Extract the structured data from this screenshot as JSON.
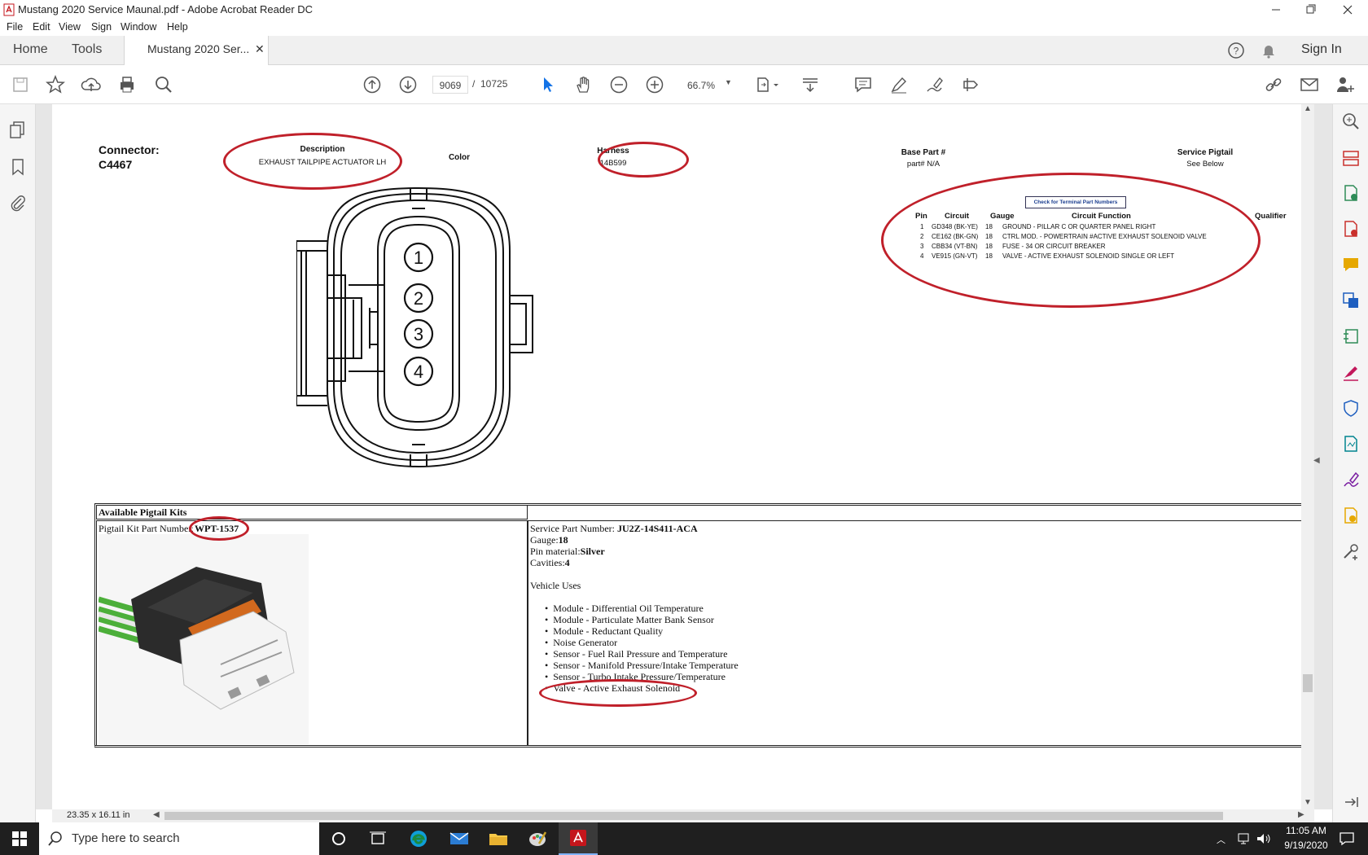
{
  "window": {
    "title": "Mustang 2020 Service Maunal.pdf - Adobe Acrobat Reader DC"
  },
  "menu": [
    "File",
    "Edit",
    "View",
    "Sign",
    "Window",
    "Help"
  ],
  "tabs": {
    "home": "Home",
    "tools": "Tools",
    "document": "Mustang 2020 Ser...",
    "sign_in": "Sign In"
  },
  "toolbar": {
    "page_current": "9069",
    "page_sep": "/",
    "page_total": "10725",
    "zoom": "66.7%"
  },
  "document": {
    "connector_label": "Connector:",
    "connector_id": "C4467",
    "description_label": "Description",
    "description_value": "EXHAUST TAILPIPE ACTUATOR LH",
    "color_label": "Color",
    "harness_label": "Harness",
    "harness_value": "14B599",
    "base_part_label": "Base Part #",
    "base_part_value": "part# N/A",
    "service_pigtail_label": "Service Pigtail",
    "service_pigtail_value": "See Below",
    "terminal_button": "Check for Terminal Part Numbers",
    "pin_table": {
      "headers": [
        "Pin",
        "Circuit",
        "Gauge",
        "Circuit Function",
        "Qualifier"
      ],
      "rows": [
        [
          "1",
          "GD348 (BK-YE)",
          "18",
          "GROUND - PILLAR C OR QUARTER PANEL RIGHT"
        ],
        [
          "2",
          "CE162 (BK-GN)",
          "18",
          "CTRL MOD. - POWERTRAIN #ACTIVE EXHAUST SOLENOID VALVE"
        ],
        [
          "3",
          "CBB34 (VT-BN)",
          "18",
          "FUSE - 34 OR CIRCUIT BREAKER"
        ],
        [
          "4",
          "VE915 (GN-VT)",
          "18",
          "VALVE - ACTIVE EXHAUST SOLENOID SINGLE OR LEFT"
        ]
      ]
    },
    "pin_labels": [
      "1",
      "2",
      "3",
      "4"
    ],
    "kits_title": "Available Pigtail Kits",
    "kit_label": "Pigtail Kit Part Number:",
    "kit_number": "WPT-1537",
    "service_part_label": "Service Part Number: ",
    "service_part_value": "JU2Z-14S411-ACA",
    "gauge_label": "Gauge:",
    "gauge_value": "18",
    "pin_material_label": "Pin material:",
    "pin_material_value": "Silver",
    "cavities_label": "Cavities:",
    "cavities_value": "4",
    "vehicle_uses_label": "Vehicle Uses",
    "vehicle_uses": [
      "Module - Differential Oil Temperature",
      "Module - Particulate Matter Bank Sensor",
      "Module - Reductant Quality",
      "Noise Generator",
      "Sensor - Fuel Rail Pressure and Temperature",
      "Sensor - Manifold Pressure/Intake Temperature",
      "Sensor - Turbo Intake Pressure/Temperature",
      "Valve - Active Exhaust Solenoid"
    ]
  },
  "status": {
    "page_size": "23.35 x 16.11 in"
  },
  "taskbar": {
    "search_placeholder": "Type here to search",
    "time": "11:05 AM",
    "date": "9/19/2020"
  },
  "colors": {
    "annotation_red": "#c0202a",
    "acrobat_red": "#c4161c",
    "taskbar": "#1f1f1f",
    "select_blue": "#1473e6"
  }
}
